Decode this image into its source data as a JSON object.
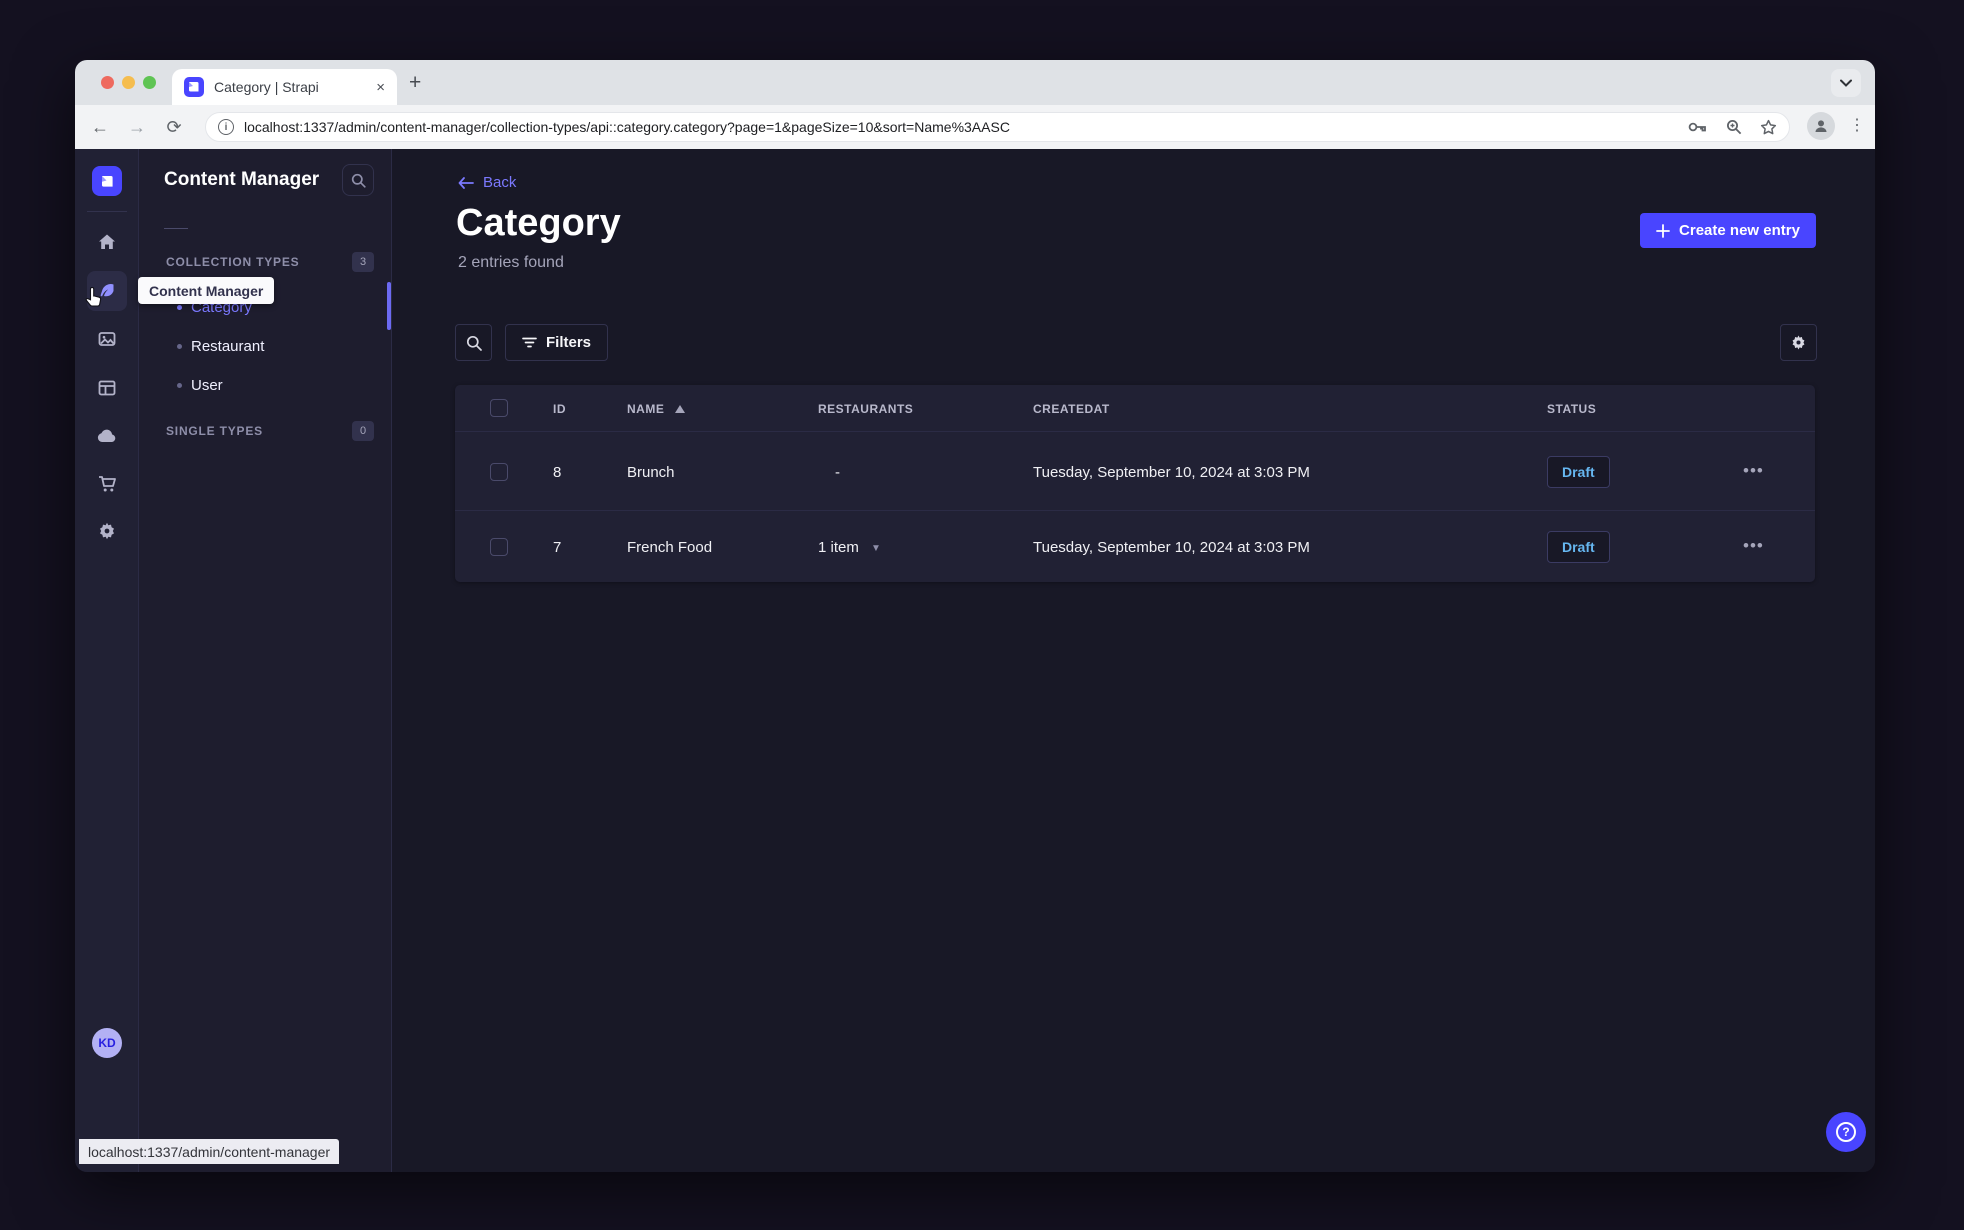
{
  "browser": {
    "tab": {
      "title": "Category | Strapi",
      "close": "×",
      "new_tab": "+"
    },
    "url": "localhost:1337/admin/content-manager/collection-types/api::category.category?page=1&pageSize=10&sort=Name%3AASC",
    "status_bar_url": "localhost:1337/admin/content-manager"
  },
  "rail": {
    "workspace_initials": "KD",
    "icons": [
      "strapi-logo",
      "home",
      "content-manager",
      "media-library",
      "content-type-builder",
      "cloud",
      "marketplace",
      "settings"
    ]
  },
  "subnav": {
    "title": "Content Manager",
    "tooltip": "Content Manager",
    "collection_types_label": "COLLECTION TYPES",
    "collection_types_count": "3",
    "single_types_label": "SINGLE TYPES",
    "single_types_count": "0",
    "items": [
      {
        "label": "Category",
        "active": true
      },
      {
        "label": "Restaurant",
        "active": false
      },
      {
        "label": "User",
        "active": false
      }
    ]
  },
  "main": {
    "back_label": "Back",
    "title": "Category",
    "subtitle": "2 entries found",
    "create_button_label": "Create new entry",
    "filters_button_label": "Filters",
    "table": {
      "headers": {
        "id": "ID",
        "name": "NAME",
        "restaurants": "RESTAURANTS",
        "createdat": "CREATEDAT",
        "status": "STATUS"
      },
      "rows": [
        {
          "id": "8",
          "name": "Brunch",
          "restaurants": "-",
          "createdat": "Tuesday, September 10, 2024 at 3:03 PM",
          "status": "Draft"
        },
        {
          "id": "7",
          "name": "French Food",
          "restaurants": "1 item",
          "createdat": "Tuesday, September 10, 2024 at 3:03 PM",
          "status": "Draft"
        }
      ]
    }
  },
  "colors": {
    "accent": "#4945ff",
    "accent_light": "#7b79ff",
    "draft_text": "#66b7f1",
    "surface": "#212134",
    "background": "#181826"
  }
}
